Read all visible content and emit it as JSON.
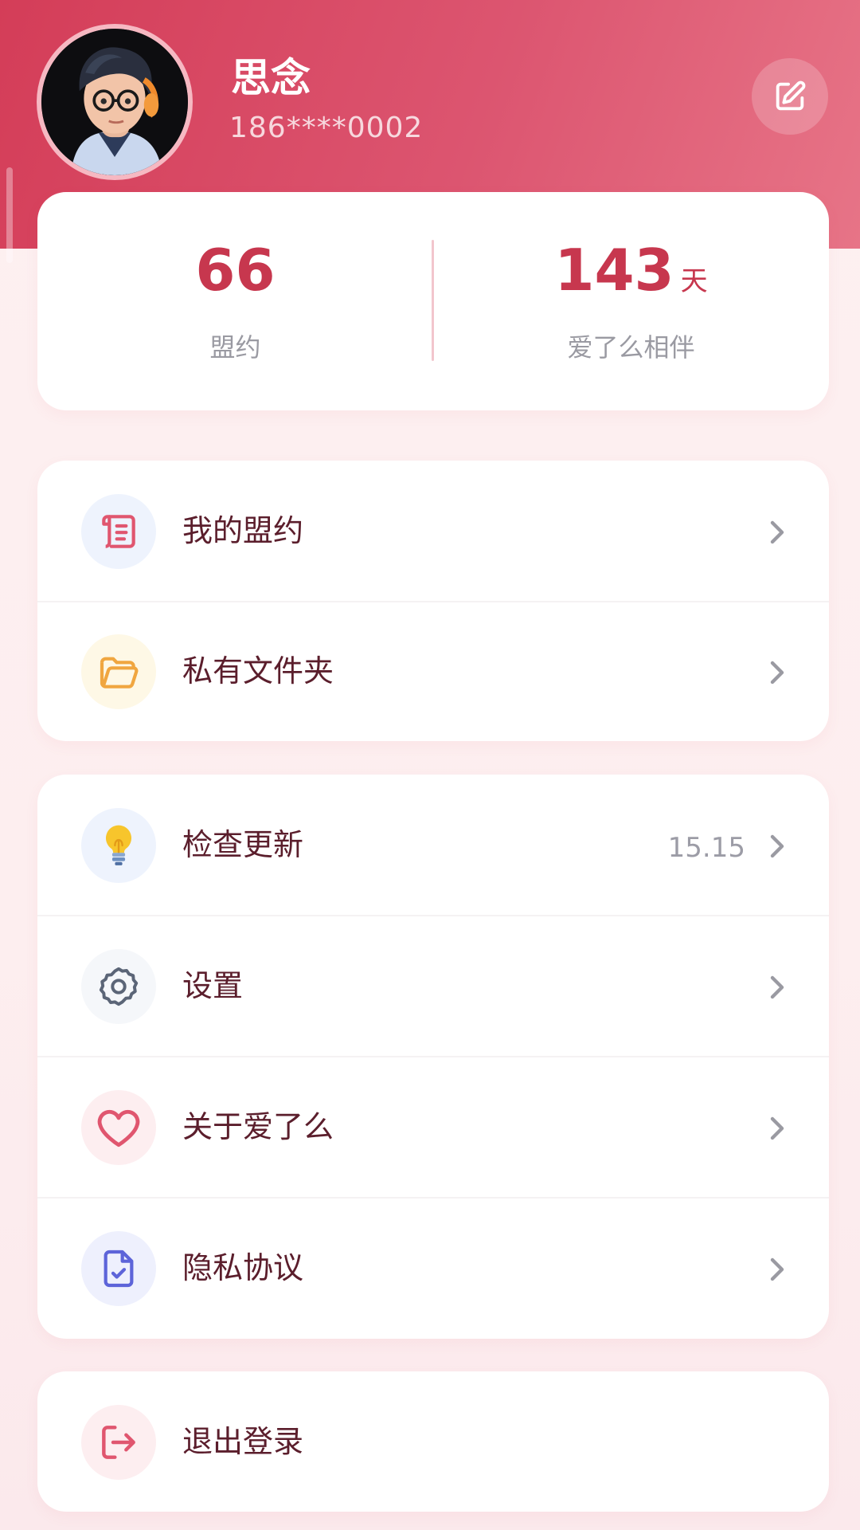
{
  "profile": {
    "name": "思念",
    "phone": "186****0002",
    "edit_icon": "edit-icon"
  },
  "stats": {
    "pledges": {
      "value": "66",
      "label": "盟约"
    },
    "days": {
      "value": "143",
      "unit": "天",
      "label": "爱了么相伴"
    }
  },
  "menu_group_1": [
    {
      "label": "我的盟约",
      "icon": "scroll-icon",
      "icon_color": "#e0566f",
      "bg": "#eef3fd"
    },
    {
      "label": "私有文件夹",
      "icon": "folder-icon",
      "icon_color": "#f0a640",
      "bg": "#fef8e6"
    }
  ],
  "menu_group_2": [
    {
      "label": "检查更新",
      "icon": "lightbulb-icon",
      "extra": "15.15",
      "bg": "#eef3fd"
    },
    {
      "label": "设置",
      "icon": "gear-icon",
      "icon_color": "#5b6577",
      "bg": "#f5f7fa"
    },
    {
      "label": "关于爱了么",
      "icon": "heart-icon",
      "icon_color": "#e0566f",
      "bg": "#fdeef0"
    },
    {
      "label": "隐私协议",
      "icon": "document-check-icon",
      "icon_color": "#5d64d9",
      "bg": "#eef0fd"
    }
  ],
  "logout": {
    "label": "退出登录",
    "icon": "logout-icon",
    "icon_color": "#e0566f",
    "bg": "#fdeef0"
  },
  "colors": {
    "header_start": "#d43d58",
    "header_end": "#e77487",
    "accent": "#c7374e",
    "menu_text": "#5b1e2c"
  }
}
